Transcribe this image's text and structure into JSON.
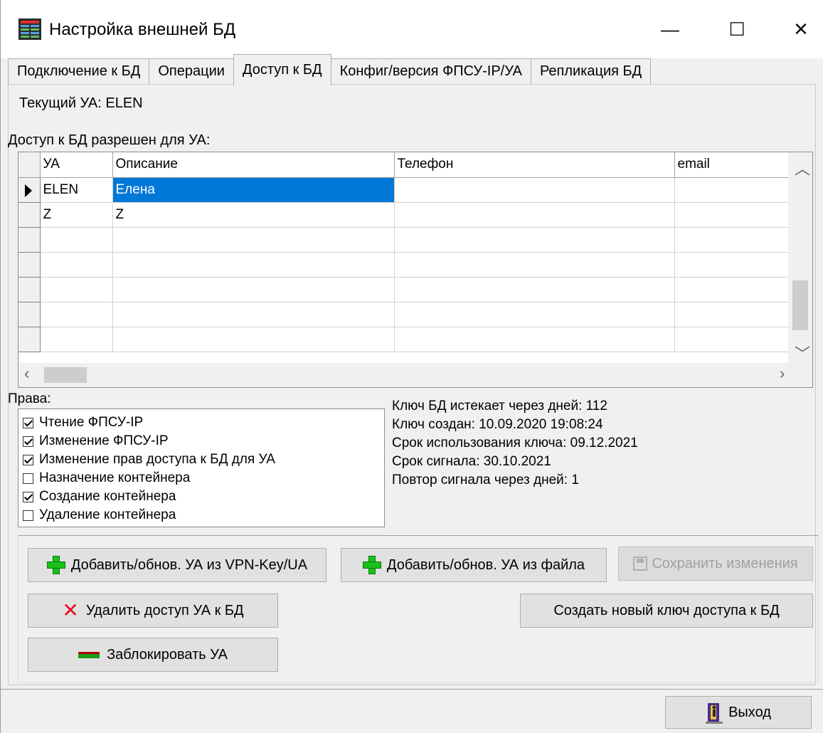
{
  "window": {
    "title": "Настройка внешней БД",
    "minimize_glyph": "—",
    "maximize_glyph": "☐",
    "close_glyph": "✕"
  },
  "tabs": [
    {
      "label": "Подключение к БД",
      "active": false
    },
    {
      "label": "Операции",
      "active": false
    },
    {
      "label": "Доступ к БД",
      "active": true
    },
    {
      "label": "Конфиг/версия ФПСУ-IP/УА",
      "active": false
    },
    {
      "label": "Репликация БД",
      "active": false
    }
  ],
  "current_ua": "Текущий УА: ELEN",
  "grid_caption": "Доступ к БД разрешен для УА:",
  "grid": {
    "columns": [
      "УА",
      "Описание",
      "Телефон",
      "email"
    ],
    "rows": [
      {
        "ua": "ELEN",
        "desc": "Елена",
        "phone": "",
        "email": ""
      },
      {
        "ua": "Z",
        "desc": "Z",
        "phone": "",
        "email": ""
      },
      {
        "ua": "",
        "desc": "",
        "phone": "",
        "email": ""
      },
      {
        "ua": "",
        "desc": "",
        "phone": "",
        "email": ""
      },
      {
        "ua": "",
        "desc": "",
        "phone": "",
        "email": ""
      },
      {
        "ua": "",
        "desc": "",
        "phone": "",
        "email": ""
      },
      {
        "ua": "",
        "desc": "",
        "phone": "",
        "email": ""
      }
    ]
  },
  "rights": {
    "label": "Права:",
    "items": [
      {
        "label": "Чтение ФПСУ-IP",
        "checked": true
      },
      {
        "label": "Изменение ФПСУ-IP",
        "checked": true
      },
      {
        "label": "Изменение прав доступа к БД для УА",
        "checked": true
      },
      {
        "label": "Назначение контейнера",
        "checked": false
      },
      {
        "label": "Создание контейнера",
        "checked": true
      },
      {
        "label": "Удаление контейнера",
        "checked": false
      }
    ]
  },
  "key_info": [
    "Ключ БД истекает через дней: 112",
    "Ключ создан: 10.09.2020 19:08:24",
    "Срок использования ключа: 09.12.2021",
    "Срок сигнала: 30.10.2021",
    "Повтор сигнала через дней: 1"
  ],
  "buttons": {
    "add_vpn": "Добавить/обнов. УА из VPN-Key/UA",
    "add_file": "Добавить/обнов. УА из файла",
    "save": "Сохранить изменения",
    "delete_access": "Удалить доступ УА  к БД",
    "new_key": "Создать новый ключ доступа к БД",
    "block": "Заблокировать УА",
    "exit": "Выход"
  },
  "colors": {
    "selection": "#0078d7",
    "plus_icon": "#19c119",
    "x_icon": "#e81123"
  }
}
